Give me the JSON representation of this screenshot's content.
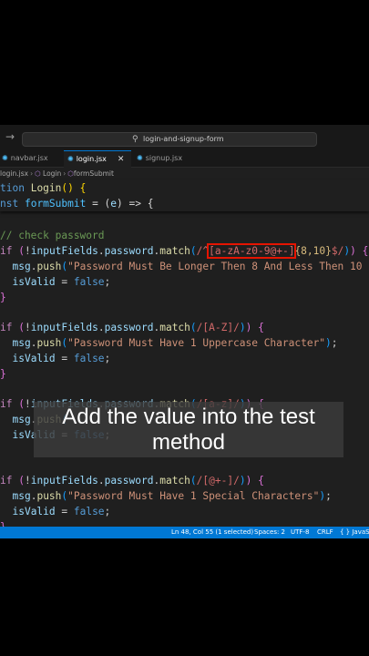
{
  "command_center": {
    "text": "login-and-signup-form",
    "icon": "search-icon"
  },
  "tabs": [
    {
      "label": "navbar.jsx",
      "active": false
    },
    {
      "label": "login.jsx",
      "active": true
    },
    {
      "label": "signup.jsx",
      "active": false
    }
  ],
  "breadcrumb": {
    "file": "login.jsx",
    "func1": "Login",
    "func2": "formSubmit"
  },
  "code": {
    "l1_kw": "tion",
    "l1_fn": "Login",
    "l1_rest": "() {",
    "l2_kw": "nst",
    "l2_var": "formSubmit",
    "l2_mid": " = (",
    "l2_param": "e",
    "l2_rest": ") => {",
    "comment": "// check password",
    "if": "if",
    "b1_obj": "inputFields",
    "b1_prop": "password",
    "b1_fn": "match",
    "b1_rx_pre": "/^",
    "b1_rx_set": "[a-zA-z0-9@+-]",
    "b1_rx_q": "{8,10}",
    "b1_rx_post": "$/",
    "push": "push",
    "msg": "msg",
    "b1_msg": "\"Password Must Be Longer Then 8 And Less Then 10",
    "isvalid": "isValid",
    "false": "false",
    "b2_rx": "/[A-Z]/",
    "b2_msg": "\"Password Must Have 1 Uppercase Character\"",
    "b3_rx": "/[a-z]/",
    "b4_rx": "/[@+-]/",
    "b4_msg": "\"Password Must Have 1 Special Characters\""
  },
  "status": {
    "position": "Ln 48, Col 55 (1 selected)",
    "spaces": "Spaces: 2",
    "encoding": "UTF-8",
    "eol": "CRLF",
    "language": "{ } JavaS"
  },
  "caption": "Add the value into the test method"
}
